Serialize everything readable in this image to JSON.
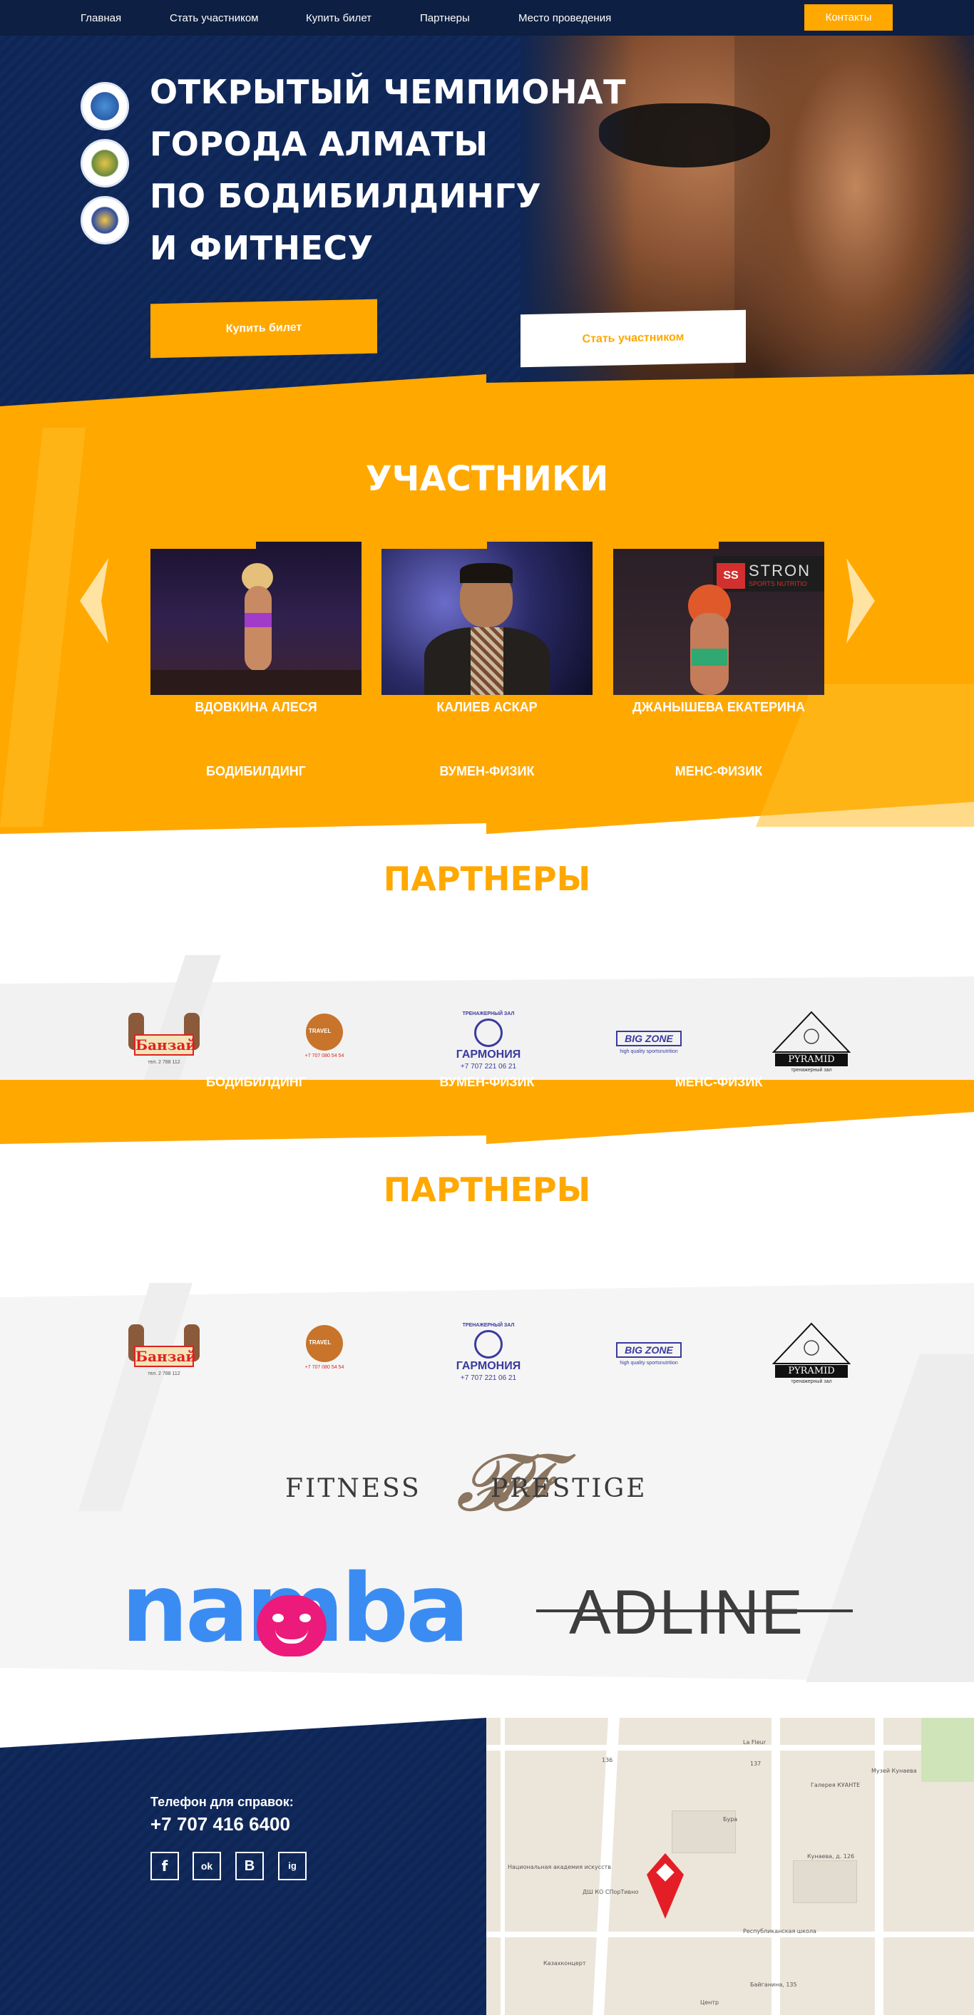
{
  "nav": {
    "items": [
      "Главная",
      "Стать участником",
      "Купить билет",
      "Партнеры",
      "Место проведения"
    ],
    "contacts": "Контакты"
  },
  "hero": {
    "title_lines": [
      "ОТКРЫТЫЙ ЧЕМПИОНАТ",
      "ГОРОДА АЛМАТЫ",
      "ПО БОДИБИЛДИНГУ",
      "И ФИТНЕСУ"
    ],
    "buy_button": "Купить билет",
    "join_button": "Стать участником"
  },
  "participants": {
    "title": "УЧАСТНИКИ",
    "cards": [
      {
        "name": "ВДОВКИНА АЛЕСЯ",
        "category": "БОДИБИЛДИНГ"
      },
      {
        "name": "КАЛИЕВ АСКАР",
        "category": "ВУМЕН-ФИЗИК"
      },
      {
        "name": "ДЖАНЫШЕВА ЕКАТЕРИНА",
        "category": "МЕНС-ФИЗИК"
      }
    ],
    "card3_sign": "STRON",
    "card3_sign_sub": "SPORTS NUTRITIO"
  },
  "partners": {
    "title": "ПАРТНЕРЫ",
    "logos": [
      {
        "name": "Банзай",
        "sub": "тел. 2 788 112"
      },
      {
        "name": "TRAVEL",
        "sub": "+7 707 080 54 54"
      },
      {
        "name": "ГАРМОНИЯ",
        "top": "ТРЕНАЖЕРНЫЙ ЗАЛ",
        "sub": "+7 707 221 06 21"
      },
      {
        "name": "BIG ZONE",
        "sub": "high quality sportsnutrition"
      },
      {
        "name": "PYRAMID",
        "sub": "тренажерный зал"
      }
    ],
    "overlap_categories": [
      "БОДИБИЛДИНГ",
      "ВУМЕН-ФИЗИК",
      "МЕНС-ФИЗИК"
    ],
    "fitness_prestige": {
      "left": "FITNESS",
      "right": "PRESTIGE"
    },
    "namba": "namba",
    "adline": "ADLINE"
  },
  "footer": {
    "phone_label": "Телефон для справок:",
    "phone": "+7 707 416 6400",
    "social": [
      "f",
      "ok",
      "B",
      "ig"
    ]
  },
  "map": {
    "labels": [
      "La Fleur",
      "Музей Кунаева",
      "Галерея КУАНТЕ",
      "Кунаева, д. 126",
      "Бура",
      "ДШ КО СПорТивно",
      "Национальная академия искусств",
      "Республиканская школа",
      "Казахконцерт",
      "Байганина, 135",
      "136",
      "137",
      "Центр"
    ],
    "pin_color": "#e41e26"
  },
  "colors": {
    "navy": "#0d1f42",
    "orange": "#ffa800",
    "white": "#ffffff",
    "namba_blue": "#3b8cf2",
    "namba_pink": "#ec1a7a",
    "adline_grey": "#3d3d3d",
    "prestige_brown": "#8a7560"
  }
}
